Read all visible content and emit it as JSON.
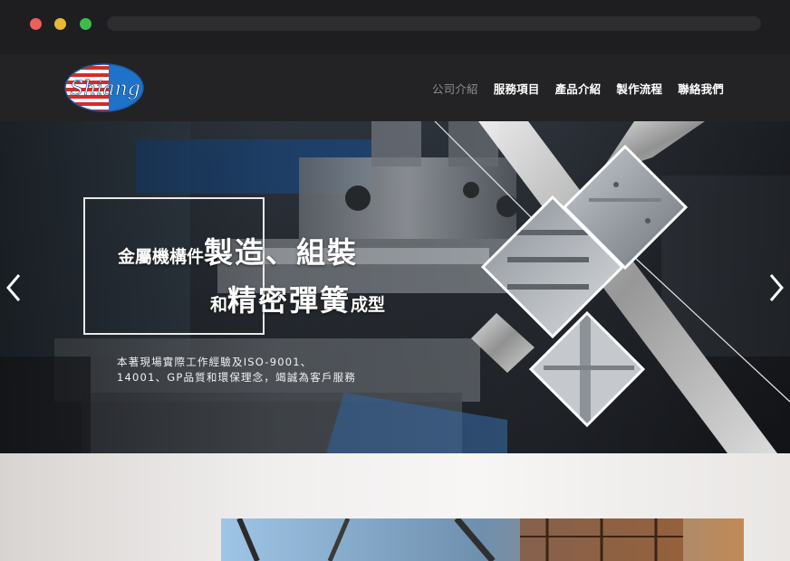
{
  "browser": {
    "controls": [
      "close",
      "minimize",
      "maximize"
    ]
  },
  "header": {
    "logo_text": "Shiang",
    "nav": [
      {
        "label": "公司介紹",
        "active": true
      },
      {
        "label": "服務項目",
        "active": false
      },
      {
        "label": "產品介紹",
        "active": false
      },
      {
        "label": "製作流程",
        "active": false
      },
      {
        "label": "聯絡我們",
        "active": false
      }
    ]
  },
  "hero": {
    "line1_small": "金屬機構件",
    "line1_large": "製造、組裝",
    "line2_small_a": "和",
    "line2_large": "精密彈簧",
    "line2_small_b": "成型",
    "description": "本著現場實際工作經驗及ISO-9001、14001、GP品質和環保理念，竭誠為客戶服務",
    "prev_icon": "chevron-left-icon",
    "next_icon": "chevron-right-icon"
  },
  "colors": {
    "chrome": "#1e1e20",
    "header": "#232325",
    "nav_active": "#8c8c8c",
    "logo_blue": "#1e73c8",
    "logo_red": "#d62b2b"
  }
}
